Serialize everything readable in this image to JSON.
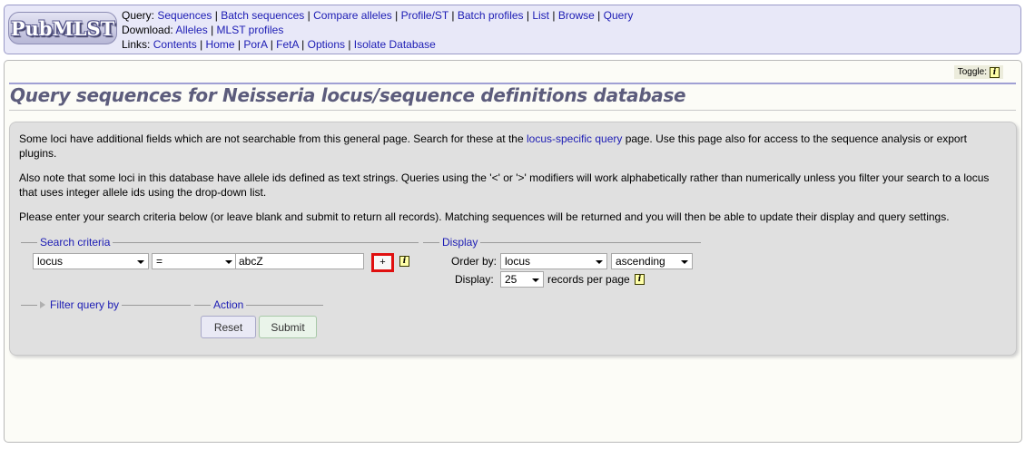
{
  "menu": {
    "logo_text": "PubMLST",
    "query_prefix": "Query:",
    "query_links": [
      "Sequences",
      "Batch sequences",
      "Compare alleles",
      "Profile/ST",
      "Batch profiles",
      "List",
      "Browse",
      "Query"
    ],
    "download_prefix": "Download:",
    "download_links": [
      "Alleles",
      "MLST profiles"
    ],
    "links_prefix": "Links:",
    "links_links": [
      "Contents",
      "Home",
      "PorA",
      "FetA",
      "Options",
      "Isolate Database"
    ],
    "separator": " | "
  },
  "toggle": {
    "label": "Toggle:",
    "icon": "info-icon"
  },
  "page_title": "Query sequences for Neisseria locus/sequence definitions database",
  "intro": {
    "p1_before": "Some loci have additional fields which are not searchable from this general page. Search for these at the ",
    "p1_link": "locus-specific query",
    "p1_after": " page. Use this page also for access to the sequence analysis or export plugins.",
    "p2": "Also note that some loci in this database have allele ids defined as text strings. Queries using the '<' or '>' modifiers will work alphabetically rather than numerically unless you filter your search to a locus that uses integer allele ids using the drop-down list.",
    "p3": "Please enter your search criteria below (or leave blank and submit to return all records). Matching sequences will be returned and you will then be able to update their display and query settings."
  },
  "search_criteria": {
    "legend": "Search criteria",
    "field_select": "locus",
    "operator_select": "=",
    "value": "abcZ",
    "add_button": "+",
    "info_icon": "info-icon"
  },
  "display": {
    "legend": "Display",
    "order_by_label": "Order by:",
    "order_by_value": "locus",
    "direction_value": "ascending",
    "display_label": "Display:",
    "display_value": "25",
    "records_label": "records per page",
    "info_icon": "info-icon"
  },
  "filter": {
    "legend": "Filter query by"
  },
  "action": {
    "legend": "Action",
    "reset_label": "Reset",
    "submit_label": "Submit"
  },
  "colors": {
    "link": "#1c1cb4",
    "menu_bg": "#e8e8f8",
    "query_box_bg": "#e0e0e0",
    "highlight_border": "#e01010",
    "title": "#5c5c7c"
  }
}
